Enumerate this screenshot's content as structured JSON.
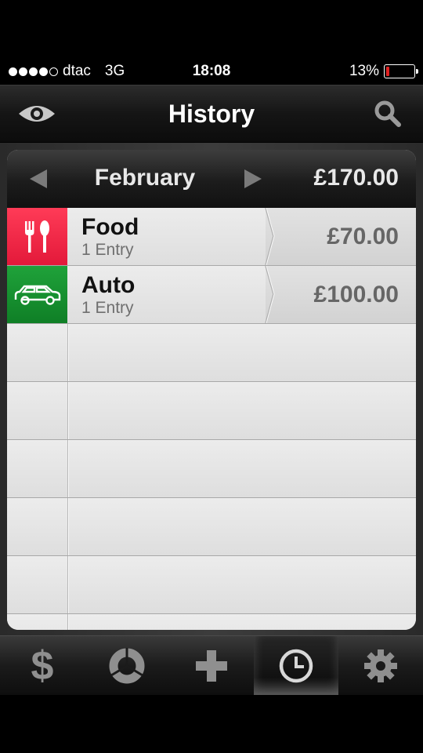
{
  "status_bar": {
    "carrier": "dtac",
    "network": "3G",
    "time": "18:08",
    "battery_percent": "13%",
    "battery_level": 0.13,
    "signal_bars_filled": 4,
    "signal_bars_total": 5
  },
  "nav": {
    "title": "History",
    "left_icon": "eye-icon",
    "right_icon": "search-icon"
  },
  "month": {
    "label": "February",
    "total": "£170.00",
    "prev_icon": "triangle-left-icon",
    "next_icon": "triangle-right-icon"
  },
  "entries": [
    {
      "name": "Food",
      "sub": "1 Entry",
      "amount": "£70.00",
      "icon": "fork-spoon-icon",
      "color": "#e8203f"
    },
    {
      "name": "Auto",
      "sub": "1 Entry",
      "amount": "£100.00",
      "icon": "car-icon",
      "color": "#138a2c"
    }
  ],
  "tabs": [
    {
      "name": "dollar",
      "icon": "dollar-icon",
      "glyph": "$",
      "active": false
    },
    {
      "name": "chart",
      "icon": "pie-chart-icon",
      "active": false
    },
    {
      "name": "add",
      "icon": "plus-icon",
      "active": false
    },
    {
      "name": "history",
      "icon": "clock-icon",
      "active": true
    },
    {
      "name": "settings",
      "icon": "gear-icon",
      "active": false
    }
  ],
  "colors": {
    "food": "#e8203f",
    "auto": "#138a2c",
    "battery_low": "#e02020"
  }
}
